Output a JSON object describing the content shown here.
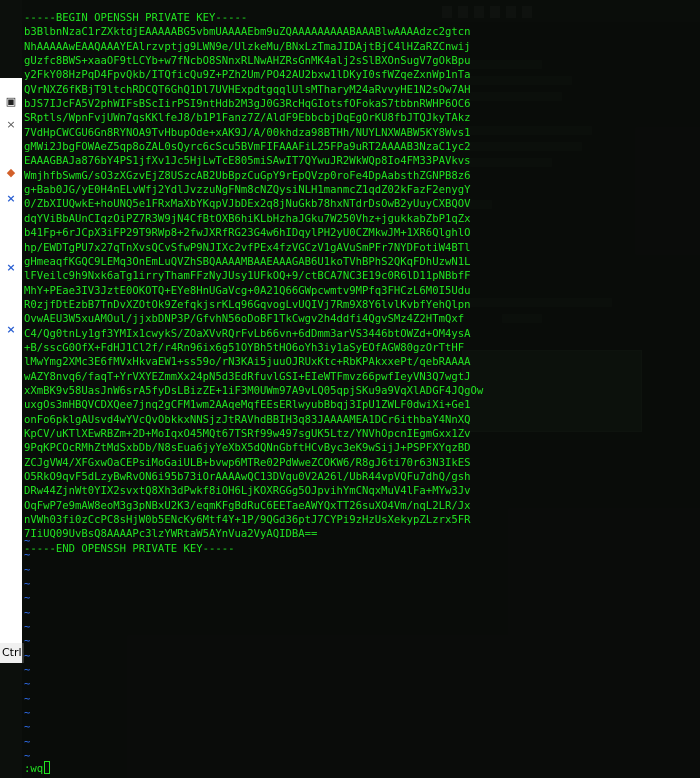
{
  "vim": {
    "lines": [
      "-----BEGIN OPENSSH PRIVATE KEY-----",
      "b3BlbnNzaC1rZXktdjEAAAAABG5vbmUAAAAEbm9uZQAAAAAAAAABAAABlwAAAAdzc2gtcn",
      "NhAAAAAwEAAQAAAYEAlrzvptjg9LWN9e/UlzkeMu/BNxLzTmaJIDAjtBjC4lHZaRZCnwij",
      "gUzfc8BWS+xaaOF9tLCYb+w7fNcbO8SNnxRLNwAHZRsGnMK4alj2sSlBXOnSugV7gOkBpu",
      "y2FkY08HzPqD4FpvQkb/ITQficQu9Z+PZh2Um/PO42AU2bxw1lDKyI0sfWZqeZxnWp1nTa",
      "QVrNXZ6fKBjT9ltchRDCQT6GhQ1Dl7UVHExpdtgqqlUlsMTharyM24aRvvyHE1N2sOw7AH",
      "bJS7IJcFA5V2phWIFsBScIirPSI9ntHdb2M3gJ0G3RcHqGIotsfOFokaS7tbbnRWHP6OC6",
      "SRptls/WpnFvjUWn7qsKKlfeJ8/b1P1Fanz7Z/AldF9EbbcbjDqEgOrKU8fbJTQJkyTAkz",
      "7VdHpCWCGU6Gn8RYNOA9TvHbupOde+xAK9J/A/00khdza98BTHh/NUYLNXWABW5KY8Wvs1",
      "gMWi2JbgFOWAeZ5qp8oZAL0sQyrc6cScu5BVmFIFAAAFiL25FPa9uRT2AAAAB3NzaC1yc2",
      "EAAAGBAJa876bY4PS1jfXv1Jc5HjLwTcE805miSAwIT7QYwuJR2WkWQp8Io4FM33PAVkvs",
      "WmjhfbSwmG/sO3zXGzvEjZ8USzcAB2UbBpzCuGpY9rEpQVzp0roFe4DpAabsthZGNPB8z6",
      "g+Bab0JG/yE0H4nELvWfj2YdlJvzzuNgFNm8cNZQysiNLH1manmcZ1qdZ02kFazF2enygY",
      "0/ZbXIUQwkE+hoUNQ5e1FRxMaXbYKqpVJbDEx2q8jNuGkb78hxNTdrDsOwB2yUuyCXBQOV",
      "dqYViBbAUnCIqzOiPZ7R3W9jN4CfBtOXB6hiKLbHzhaJGku7W250Vhz+jgukkabZbP1qZx",
      "b41Fp+6rJCpX3iFP29T9RWp8+2fwJXRfRG23G4w6hIDqylPH2yU0CZMkwJM+1XR6QlghlO",
      "hp/EWDTgPU7x27qTnXvsQCvSfwP9NJIXc2vfPEx4fzVGCzV1gAVuSmPFr7NYDFotiW4BTl",
      "gHmeaqfKGQC9LEMq3OnEmLuQVZhSBQAAAAMBAAEAAAGAB6U1koTVhBPhS2QKqFDhUzwN1L",
      "lFVeilc9h9Nxk6aTg1irryThamFFzNyJUsy1UFkOQ+9/ctBCA7NC3E19c0R6lD11pNBbfF",
      "MhY+PEae3IV3JztE0OKOTQ+EYe8HnUGaVcg+0A21Q66GWpcwmtv9MPfq3FHCzL6M0I5Udu",
      "R0zjfDtEzbB7TnDvXZOtOk9ZefqkjsrKLq96GqvogLvUQIVj7Rm9X8Y6lvlKvbfYehQlpn",
      "OvwAEU3W5xuAMOul/jjxbDNP3P/GfvhN56oDoBF1TkCwgv2h4ddfi4QgvSMz4Z2HTmQxf",
      "C4/Qg0tnLy1gf3YMIx1cwykS/ZOaXVvRQrFvLb66vn+6dDmm3arVS3446btOWZd+OM4ysA",
      "+B/sscG0OfX+FdHJ1Cl2f/r4Rn96ix6g51OYBh5tHO6oYh3iy1aSyEOfAGW80gzOrTtHF",
      "lMwYmg2XMc3E6fMVxHkvaEW1+ss59o/rN3KAi5juuOJRUxKtc+RbKPAkxxePt/qebRAAAA",
      "wAZY8nvq6/faqT+YrVXYEZmmXx24pN5d3EdRfuvlGSI+EIeWTFmvz66pwfIeyVN3Q7wgtJ",
      "xXmBK9v58UasJnW6srA5fyDsLBizZE+1iF3M0UWm97A9vLQ05qpjSKu9a9VqXlADGF4JQgOw",
      "uxgOs3mHBQVCDXQee7jnq2gCFM1wm2AAqeMqfEEsERlwyubBbqj3IpU1ZWLF0dwiXi+Ge1",
      "onFo6pklgAUsvd4wYVcQvObkkxNNSjzJtRAVhdBBIH3q83JAAAAMEA1DCr6ithbaY4NnXQ",
      "KpCV/uKTlXEwRBZm+2D+MoIqxO45MQt67TSRf99w497sgUK5Ltz/YNVhOpcnIEgmGxx1Zv",
      "9PqKPCOcRMhZtMdSxbDb/N8sEua6jyYeXbX5dQNnGbftHCvByc3eK9wSijJ+PSPFXYqzBD",
      "ZCJgVW4/XFGxwOaCEPsiMoGaiULB+bvwp6MTRe02PdWweZCOKW6/R8gJ6ti70r63N3IkES",
      "O5RkO9qvF5dLzyBwRvON6i95b73iOrAAAAwQC13DVqu0V2A26l/UbR44vpVQFu7dhQ/gsh",
      "DRw44ZjnWt0YIX2svxtQ8Xh3dPwkf8iOH6LjKOXRGGg5OJpvihYmCNqxMuV4lFa+MYw3Jv",
      "OqFwP7e9mAW8eoM3g3pNBxU2K3/eqmKFgBdRuC6EETaeAWYQxTT26suXO4Vm/nqL2LR/Jx",
      "nVWh03fi0zCcPC8sHjW0b5ENcKy6Mtf4Y+1P/9QGd36ptJ7CYPi9zHzUsXekypZLzrx5FR",
      "7IiUQ09UvBsQ8AAAAPc3lzYWRtaW5AYnVua2VyAQIDBA==",
      "-----END OPENSSH PRIVATE KEY-----"
    ],
    "empty_line_marker": "~",
    "command_line": ":wq"
  },
  "left_panel": {
    "ctrl_label": "Ctrl",
    "items": [
      {
        "glyph": "▣",
        "icon": "clipboard-icon"
      },
      {
        "glyph": "×",
        "icon": "close-icon"
      },
      {
        "glyph": "◆",
        "icon": "app-icon"
      },
      {
        "glyph": "×",
        "icon": "close-icon"
      },
      {
        "glyph": "×",
        "icon": "close-icon"
      },
      {
        "glyph": "×",
        "icon": "close-icon"
      }
    ]
  },
  "colors": {
    "terminal_text": "#21e521",
    "tilde": "#2f6ef0",
    "terminal_bg": "#0c0f0c"
  }
}
